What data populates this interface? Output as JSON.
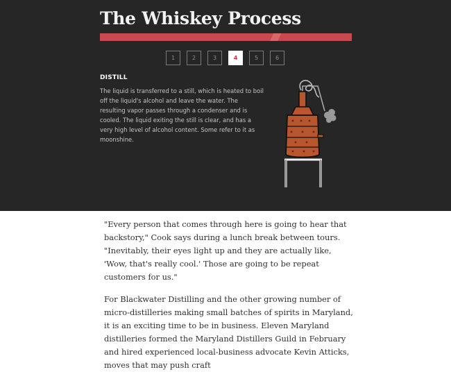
{
  "header": {
    "title": "The Whiskey Process"
  },
  "steps": {
    "items": [
      "1",
      "2",
      "3",
      "4",
      "5",
      "6"
    ],
    "active_index": 3
  },
  "current_step": {
    "heading": "DISTILL",
    "text": "The liquid is transferred to a still, which is heated to boil off the liquid's alcohol and leave the water. The resulting vapor passes through a condenser and is cooled. The liquid exiting the still is clear, and has a very high level of alcohol content. Some refer to it as moonshine.",
    "icon": "copper-still-icon"
  },
  "article": {
    "paragraphs": [
      "\"Every person that comes through here is going to hear that backstory,\" Cook says during a lunch break between tours. \"Inevitably, their eyes light up and they are actually like, 'Wow, that's really cool.' Those are going to be repeat customers for us.\"",
      "For Blackwater Distilling and the other growing number of micro-distilleries making small batches of spirits in Maryland, it is an exciting time to be in business. Eleven Maryland distilleries formed the Maryland Distillers Guild in February and hired experienced local-business advocate Kevin Atticks, moves that may push craft"
    ]
  },
  "colors": {
    "background_dark": "#262626",
    "accent": "#c84a4e",
    "copper": "#b8562e"
  }
}
